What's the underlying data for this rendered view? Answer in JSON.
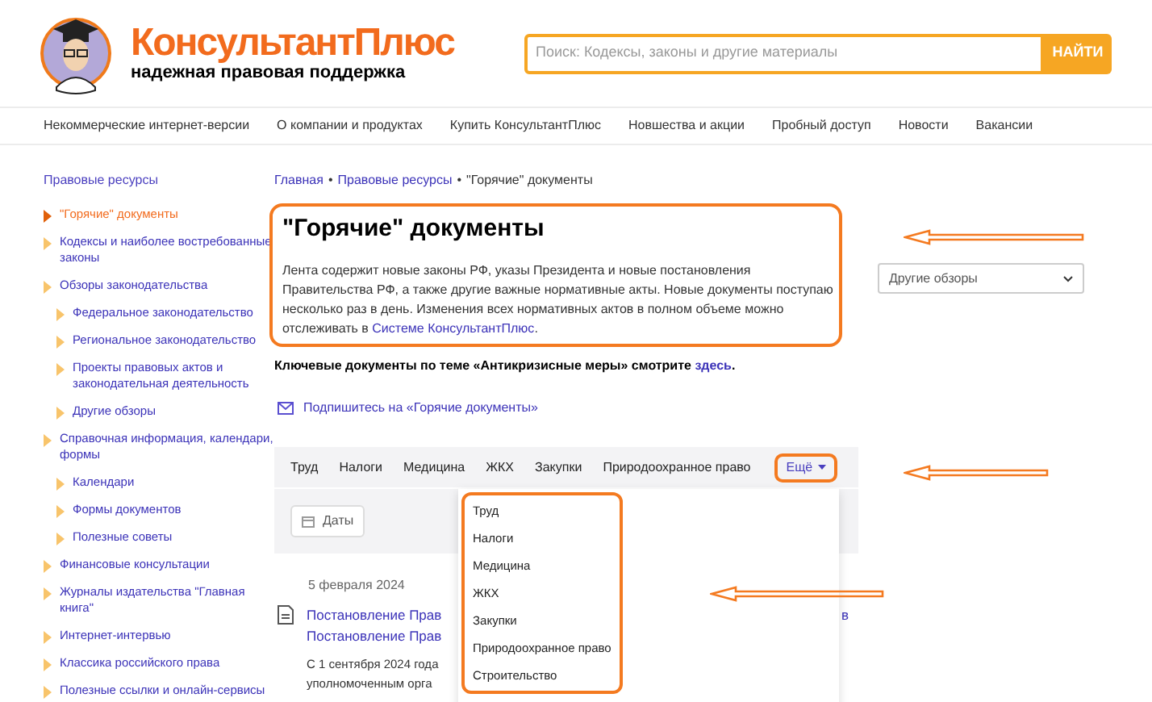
{
  "logo": {
    "brand": "КонсультантПлюс",
    "tagline": "надежная правовая поддержка"
  },
  "search": {
    "placeholder": "Поиск: Кодексы, законы и другие материалы",
    "button": "НАЙТИ"
  },
  "nav": [
    "Некоммерческие интернет-версии",
    "О компании и продуктах",
    "Купить КонсультантПлюс",
    "Новшества и акции",
    "Пробный доступ",
    "Новости",
    "Вакансии"
  ],
  "sidebar": {
    "title": "Правовые ресурсы",
    "items": [
      {
        "label": "\"Горячие\" документы",
        "selected": true
      },
      {
        "label": "Кодексы и наиболее востребованные законы",
        "selected": false
      },
      {
        "label": "Обзоры законодательства",
        "selected": false,
        "children": [
          {
            "label": "Федеральное законодательство",
            "selected": false
          },
          {
            "label": "Региональное законодательство",
            "selected": false
          },
          {
            "label": "Проекты правовых актов и законодательная деятельность",
            "selected": false
          },
          {
            "label": "Другие обзоры",
            "selected": false
          }
        ]
      },
      {
        "label": "Справочная информация, календари, формы",
        "selected": false,
        "children": [
          {
            "label": "Календари",
            "selected": false
          },
          {
            "label": "Формы документов",
            "selected": false
          },
          {
            "label": "Полезные советы",
            "selected": false
          }
        ]
      },
      {
        "label": "Финансовые консультации",
        "selected": false
      },
      {
        "label": "Журналы издательства \"Главная книга\"",
        "selected": false
      },
      {
        "label": "Интернет-интервью",
        "selected": false
      },
      {
        "label": "Классика российского права",
        "selected": false
      },
      {
        "label": "Полезные ссылки и онлайн-сервисы",
        "selected": false
      }
    ]
  },
  "breadcrumb": {
    "separator": "•",
    "items": [
      "Главная",
      "Правовые ресурсы",
      "\"Горячие\" документы"
    ]
  },
  "page": {
    "title": "\"Горячие\" документы",
    "intro_lines": [
      "Лента содержит новые законы РФ, указы Президента и новые постановления",
      "Правительства РФ, а также другие важные нормативные акты. Новые документы поступаю",
      "несколько раз в день. Изменения всех нормативных актов в полном объеме можно",
      "отслеживать в "
    ],
    "intro_link": "Системе КонсультантПлюс",
    "intro_end": ".",
    "key_note": "Ключевые документы по теме «Антикризисные меры» смотрите ",
    "key_link": "здесь",
    "key_end": ".",
    "subscribe": "Подпишитесь на «Горячие документы»"
  },
  "other_reviews": {
    "value": "Другие обзоры"
  },
  "tabs": [
    "Труд",
    "Налоги",
    "Медицина",
    "ЖКХ",
    "Закупки",
    "Природоохранное право"
  ],
  "more": {
    "label": "Ещё",
    "expanded": true
  },
  "more_menu": [
    "Труд",
    "Налоги",
    "Медицина",
    "ЖКХ",
    "Закупки",
    "Природоохранное право",
    "Строительство"
  ],
  "dates_button": "Даты",
  "documents": [
    {
      "date": "5 февраля 2024",
      "title_lines": [
        "Постановление Прав",
        "Постановление Прав"
      ],
      "title_tail": "в",
      "summary_lines": [
        "С 1 сентября 2024 года",
        "уполномоченным орга"
      ]
    }
  ]
}
